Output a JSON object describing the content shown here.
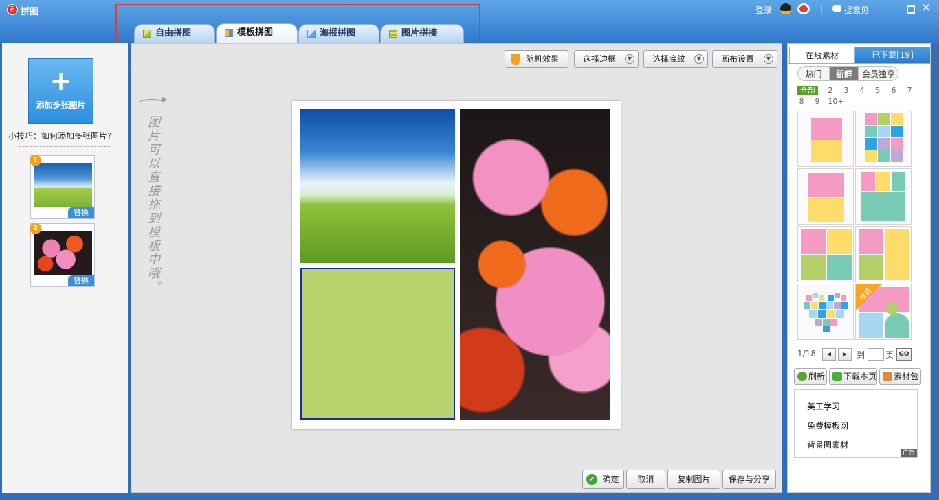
{
  "app": {
    "title": "拼图",
    "logo_text": "秀"
  },
  "titlebar": {
    "login": "登录",
    "feedback": "提意见"
  },
  "tabs": [
    {
      "label": "自由拼图",
      "active": false
    },
    {
      "label": "模板拼图",
      "active": true
    },
    {
      "label": "海报拼图",
      "active": false
    },
    {
      "label": "图片拼接",
      "active": false
    }
  ],
  "left": {
    "add_button": "添加多张图片",
    "tip": "小技巧：如何添加多张图片?",
    "thumbs": [
      {
        "num": "1",
        "replace": "替换"
      },
      {
        "num": "2",
        "replace": "替换"
      }
    ]
  },
  "toolbar": {
    "random": "随机效果",
    "border": "选择边框",
    "texture": "选择底纹",
    "canvas": "画布设置"
  },
  "hint": "图片可以直接拖到模板中哦。",
  "bottom": {
    "ok": "确定",
    "cancel": "取消",
    "copy": "复制图片",
    "save": "保存与分享"
  },
  "right": {
    "tab_online": "在线素材",
    "tab_downloaded": "已下载[19]",
    "seg_hot": "热门",
    "seg_new": "新鲜",
    "seg_member": "会员独享",
    "counts": [
      "全部",
      "2",
      "3",
      "4",
      "5",
      "6",
      "7",
      "8",
      "9",
      "10+"
    ],
    "member_badge": "会员",
    "pager": {
      "page": "1/18",
      "to": "到",
      "unit": "页",
      "go": "GO"
    },
    "refresh": "刷新",
    "download_page": "下载本页",
    "pack": "素材包",
    "ad": {
      "lines": [
        "美工学习",
        "免费模板网",
        "背景图素材"
      ],
      "mark": "广告"
    }
  },
  "colors": {
    "titlebar": "#2f78c9",
    "tile_pink": "#f59ac3",
    "tile_yellow": "#fddc6a",
    "tile_teal": "#79cbb6",
    "tile_green": "#b4cf68",
    "selected_cell": "#b7d36e",
    "selected_border": "#1b2aa3"
  }
}
